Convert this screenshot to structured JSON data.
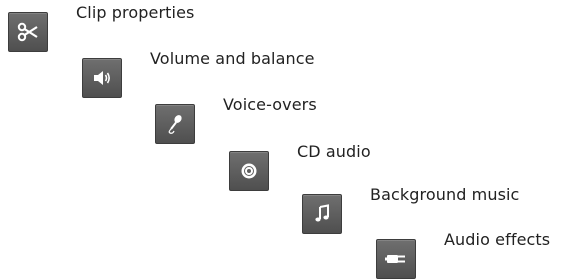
{
  "steps": [
    {
      "label": "Clip properties",
      "icon": "scissors-icon"
    },
    {
      "label": "Volume and balance",
      "icon": "speaker-icon"
    },
    {
      "label": "Voice-overs",
      "icon": "microphone-icon"
    },
    {
      "label": "CD audio",
      "icon": "cd-icon"
    },
    {
      "label": "Background music",
      "icon": "music-note-icon"
    },
    {
      "label": "Audio effects",
      "icon": "plug-icon"
    }
  ],
  "colors": {
    "tile_background": "#5f5f5f",
    "icon": "#ffffff",
    "text": "#222222",
    "page_background": "#ffffff"
  }
}
